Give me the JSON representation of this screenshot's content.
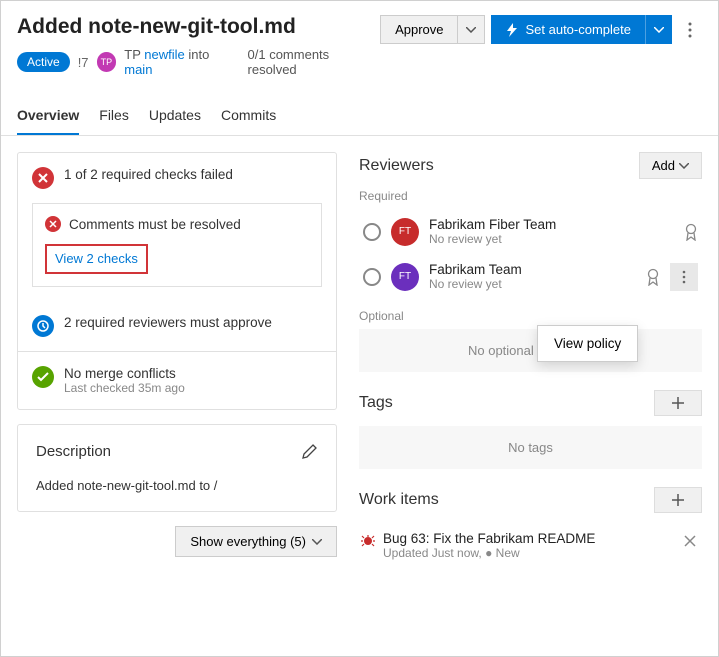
{
  "header": {
    "title": "Added note-new-git-tool.md",
    "status_badge": "Active",
    "pr_number": "!7",
    "author_initials": "TP",
    "author_name": "TP",
    "source_branch": "newfile",
    "into_word": "into",
    "target_branch": "main",
    "comments_status": "0/1 comments resolved",
    "approve_label": "Approve",
    "autocomplete_label": "Set auto-complete"
  },
  "tabs": {
    "overview": "Overview",
    "files": "Files",
    "updates": "Updates",
    "commits": "Commits"
  },
  "checks": {
    "failed_title": "1 of 2 required checks failed",
    "comments_must": "Comments must be resolved",
    "view_checks": "View 2 checks",
    "reviewers_required": "2 required reviewers must approve",
    "no_merge": "No merge conflicts",
    "no_merge_sub": "Last checked 35m ago"
  },
  "description": {
    "heading": "Description",
    "body": "Added note-new-git-tool.md to /"
  },
  "show_everything": "Show everything (5)",
  "reviewers": {
    "title": "Reviewers",
    "add_label": "Add",
    "required_label": "Required",
    "optional_label": "Optional",
    "no_optional": "No optional reviewers",
    "no_review": "No review yet",
    "items": [
      {
        "name": "Fabrikam Fiber Team",
        "initials": "FT",
        "color": "#c72c2c"
      },
      {
        "name": "Fabrikam Team",
        "initials": "FT",
        "color": "#6b2fbd"
      }
    ]
  },
  "tags": {
    "title": "Tags",
    "empty": "No tags"
  },
  "work_items": {
    "title": "Work items",
    "item_title": "Bug 63: Fix the Fabrikam README",
    "item_meta": "Updated Just now,  ●  New"
  },
  "popover": {
    "view_policy": "View policy"
  }
}
